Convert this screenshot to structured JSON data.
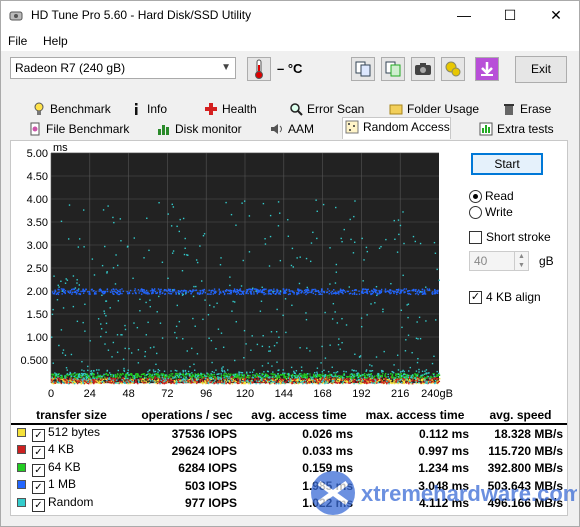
{
  "window": {
    "title": "HD Tune Pro 5.60 - Hard Disk/SSD Utility",
    "minimize": "—",
    "maximize": "☐",
    "close": "✕"
  },
  "menu": {
    "file": "File",
    "help": "Help"
  },
  "toolbar": {
    "drive": "Radeon R7 (240 gB)",
    "temperature": "– °C",
    "exit": "Exit"
  },
  "tabs_row1": [
    {
      "label": "Benchmark",
      "icon": "lightbulb-icon"
    },
    {
      "label": "Info",
      "icon": "info-icon"
    },
    {
      "label": "Health",
      "icon": "health-cross-icon"
    },
    {
      "label": "Error Scan",
      "icon": "magnifier-icon"
    },
    {
      "label": "Folder Usage",
      "icon": "folder-icon"
    },
    {
      "label": "Erase",
      "icon": "trash-icon"
    }
  ],
  "tabs_row2": [
    {
      "label": "File Benchmark",
      "icon": "file-benchmark-icon"
    },
    {
      "label": "Disk monitor",
      "icon": "bar-chart-icon"
    },
    {
      "label": "AAM",
      "icon": "speaker-icon"
    },
    {
      "label": "Random Access",
      "icon": "random-access-icon",
      "active": true
    },
    {
      "label": "Extra tests",
      "icon": "extra-tests-icon"
    }
  ],
  "side": {
    "start": "Start",
    "read": "Read",
    "write": "Write",
    "mode": "read",
    "short_stroke": "Short stroke",
    "short_stroke_checked": false,
    "stroke_value": "40",
    "gb": "gB",
    "align": "4 KB align",
    "align_checked": true
  },
  "chart_data": {
    "type": "scatter",
    "ylabel": "ms",
    "xlabel": "",
    "xunit_label": "240gB",
    "x_ticks": [
      "0",
      "24",
      "48",
      "72",
      "96",
      "120",
      "144",
      "168",
      "192",
      "216"
    ],
    "y_ticks": [
      "5.00",
      "4.50",
      "4.00",
      "3.50",
      "3.00",
      "2.50",
      "2.00",
      "1.50",
      "1.00",
      "0.500"
    ],
    "xlim": [
      0,
      240
    ],
    "ylim": [
      0,
      5
    ],
    "grid": true,
    "series": [
      {
        "name": "512 bytes",
        "color": "#f4e13a",
        "band": [
          0.0,
          0.11
        ],
        "mean": 0.026
      },
      {
        "name": "4 KB",
        "color": "#cc2020",
        "band": [
          0.0,
          0.15
        ],
        "mean": 0.033
      },
      {
        "name": "64 KB",
        "color": "#22cc22",
        "band": [
          0.12,
          0.22
        ],
        "mean": 0.159
      },
      {
        "name": "1 MB",
        "color": "#2266ff",
        "band": [
          1.94,
          2.06
        ],
        "mean": 1.985
      },
      {
        "name": "Random",
        "color": "#33cccc",
        "band": [
          0.0,
          4.0
        ],
        "mean": 1.022
      }
    ]
  },
  "results": {
    "headers": [
      "transfer size",
      "operations / sec",
      "avg. access time",
      "max. access time",
      "avg. speed"
    ],
    "rows": [
      {
        "label": "512 bytes",
        "color": "#f4e13a",
        "ops": "37536 IOPS",
        "avg": "0.026 ms",
        "max": "0.112 ms",
        "speed": "18.328 MB/s"
      },
      {
        "label": "4 KB",
        "color": "#cc2020",
        "ops": "29624 IOPS",
        "avg": "0.033 ms",
        "max": "0.997 ms",
        "speed": "115.720 MB/s"
      },
      {
        "label": "64 KB",
        "color": "#22cc22",
        "ops": "6284 IOPS",
        "avg": "0.159 ms",
        "max": "1.234 ms",
        "speed": "392.800 MB/s"
      },
      {
        "label": "1 MB",
        "color": "#2266ff",
        "ops": "503 IOPS",
        "avg": "1.985 ms",
        "max": "3.048 ms",
        "speed": "503.643 MB/s"
      },
      {
        "label": "Random",
        "color": "#33cccc",
        "ops": "977 IOPS",
        "avg": "1.022 ms",
        "max": "4.112 ms",
        "speed": "496.166 MB/s"
      }
    ]
  },
  "watermark": {
    "text": "xtremehardware.com"
  }
}
